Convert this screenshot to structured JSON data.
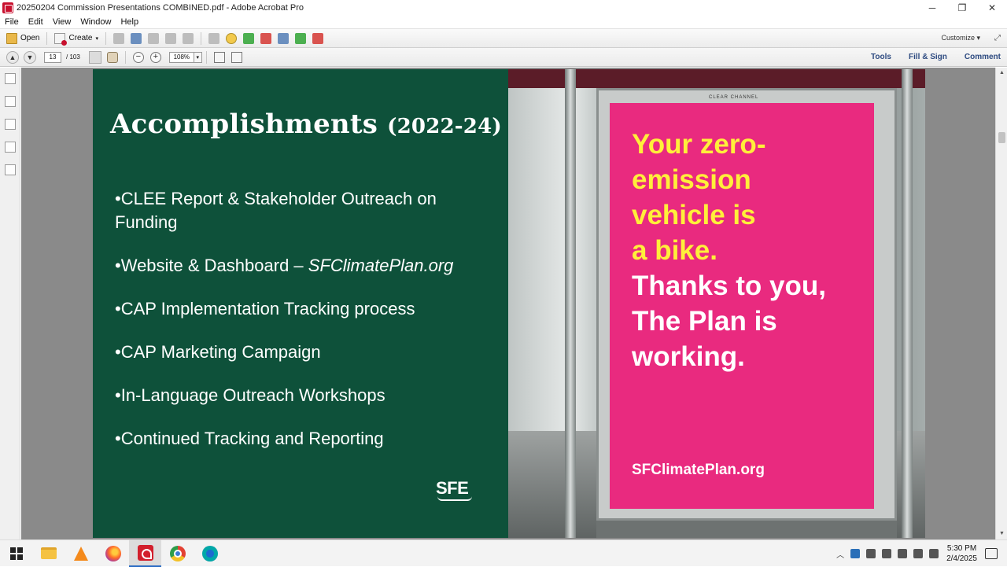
{
  "window": {
    "title": "20250204 Commission Presentations COMBINED.pdf - Adobe Acrobat Pro",
    "minimize": "─",
    "restore": "❐",
    "close": "✕"
  },
  "menu": [
    "File",
    "Edit",
    "View",
    "Window",
    "Help"
  ],
  "toolbar": {
    "open_label": "Open",
    "create_label": "Create",
    "customize_label": "Customize"
  },
  "nav": {
    "current_page": "13",
    "total_pages": "/ 103",
    "zoom": "108%",
    "right_links": [
      "Tools",
      "Fill & Sign",
      "Comment"
    ]
  },
  "slide": {
    "title_main": "Accomplishments",
    "title_years": "(2022-24)",
    "bullets": [
      "•CLEE Report & Stakeholder Outreach on Funding",
      "•Website & Dashboard – ",
      "•CAP Implementation Tracking process",
      "•CAP Marketing Campaign",
      "•In-Language Outreach Workshops",
      "•Continued Tracking and Reporting"
    ],
    "bullet2_italic": "SFClimatePlan.org",
    "logo": "SFE",
    "poster": {
      "frame_label": "CLEAR CHANNEL",
      "yellow_lines": [
        "Your zero-",
        "emission",
        "vehicle is",
        "a bike."
      ],
      "white_lines": [
        "Thanks to you,",
        "The Plan is",
        "working."
      ],
      "url": "SFClimatePlan.org"
    }
  },
  "taskbar": {
    "time": "5:30 PM",
    "date": "2/4/2025"
  },
  "colors": {
    "slide_green": "#0e513a",
    "poster_pink": "#e92a7f",
    "poster_yellow": "#ffef3a"
  }
}
